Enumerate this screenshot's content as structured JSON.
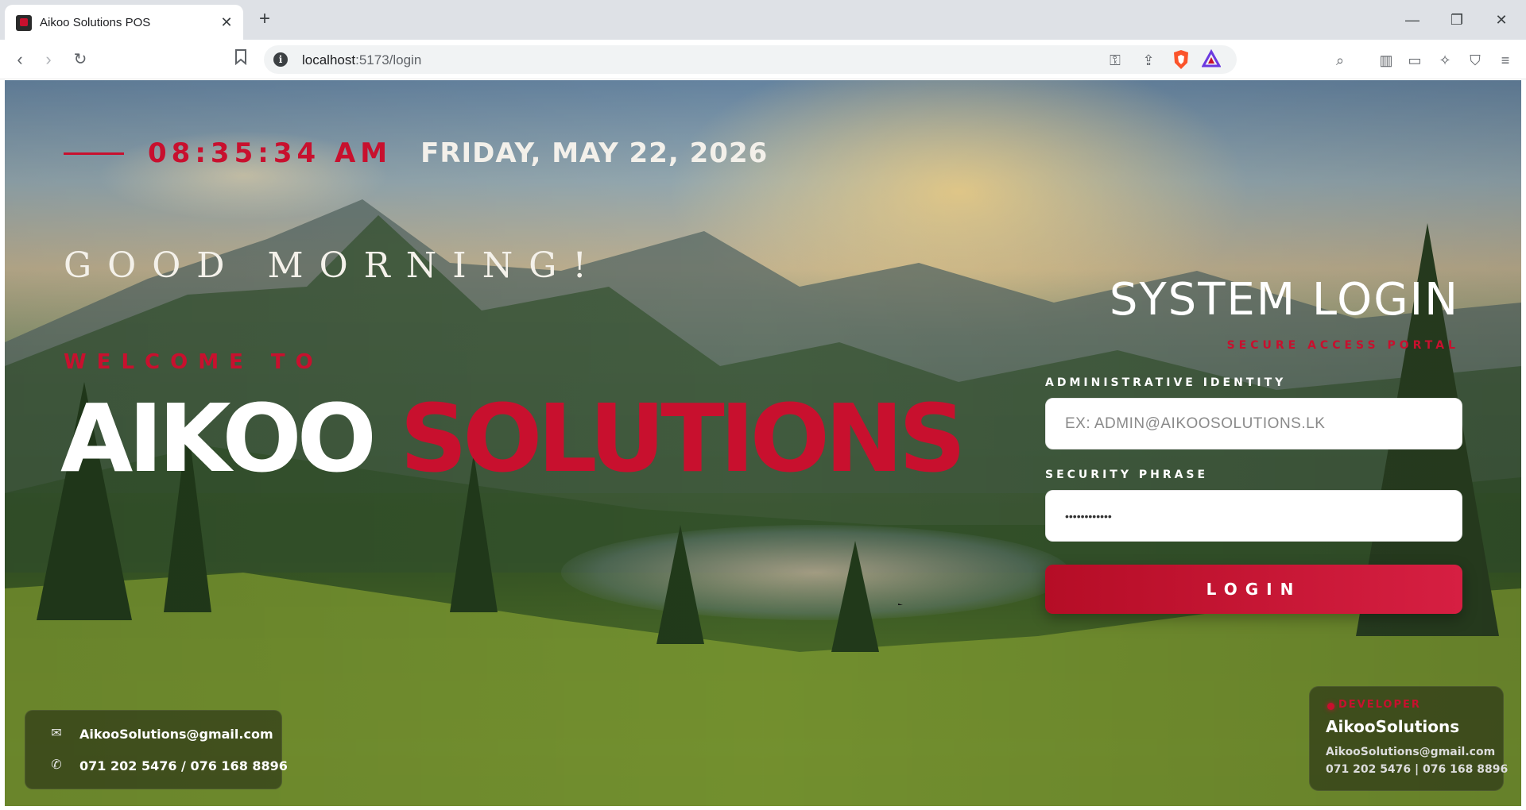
{
  "browser": {
    "tab_title": "Aikoo Solutions POS",
    "url_host": "localhost",
    "url_path": ":5173/login",
    "icons": [
      "back-icon",
      "forward-icon",
      "reload-icon",
      "bookmark-icon",
      "site-info-icon",
      "key-icon",
      "share-icon",
      "brave-shields-icon",
      "brave-rewards-icon",
      "tab-search-icon",
      "sidebar-icon",
      "wallet-icon",
      "leo-ai-icon",
      "vpn-icon",
      "menu-icon"
    ]
  },
  "header": {
    "time": "08:35:34 AM",
    "date": "FRIDAY, MAY 22, 2026"
  },
  "hero": {
    "greeting": "GOOD MORNING!",
    "welcome": "WELCOME TO",
    "brand_white": "AIKOO",
    "brand_red": "SOLUTIONS"
  },
  "login": {
    "title": "SYSTEM LOGIN",
    "subtitle": "SECURE ACCESS PORTAL",
    "identity_label": "ADMINISTRATIVE IDENTITY",
    "identity_placeholder": "EX: ADMIN@AIKOOSOLUTIONS.LK",
    "identity_value": "",
    "phrase_label": "SECURITY PHRASE",
    "phrase_value": "••••••••••••",
    "button": "LOGIN"
  },
  "contact": {
    "email": "AikooSolutions@gmail.com",
    "phone": "071 202 5476 / 076 168 8896"
  },
  "developer": {
    "label": "DEVELOPER",
    "name": "AikooSolutions",
    "email": "AikooSolutions@gmail.com",
    "phone": "071 202 5476 | 076 168 8896"
  },
  "colors": {
    "accent": "#c8102e",
    "text_light": "#ffffff"
  }
}
